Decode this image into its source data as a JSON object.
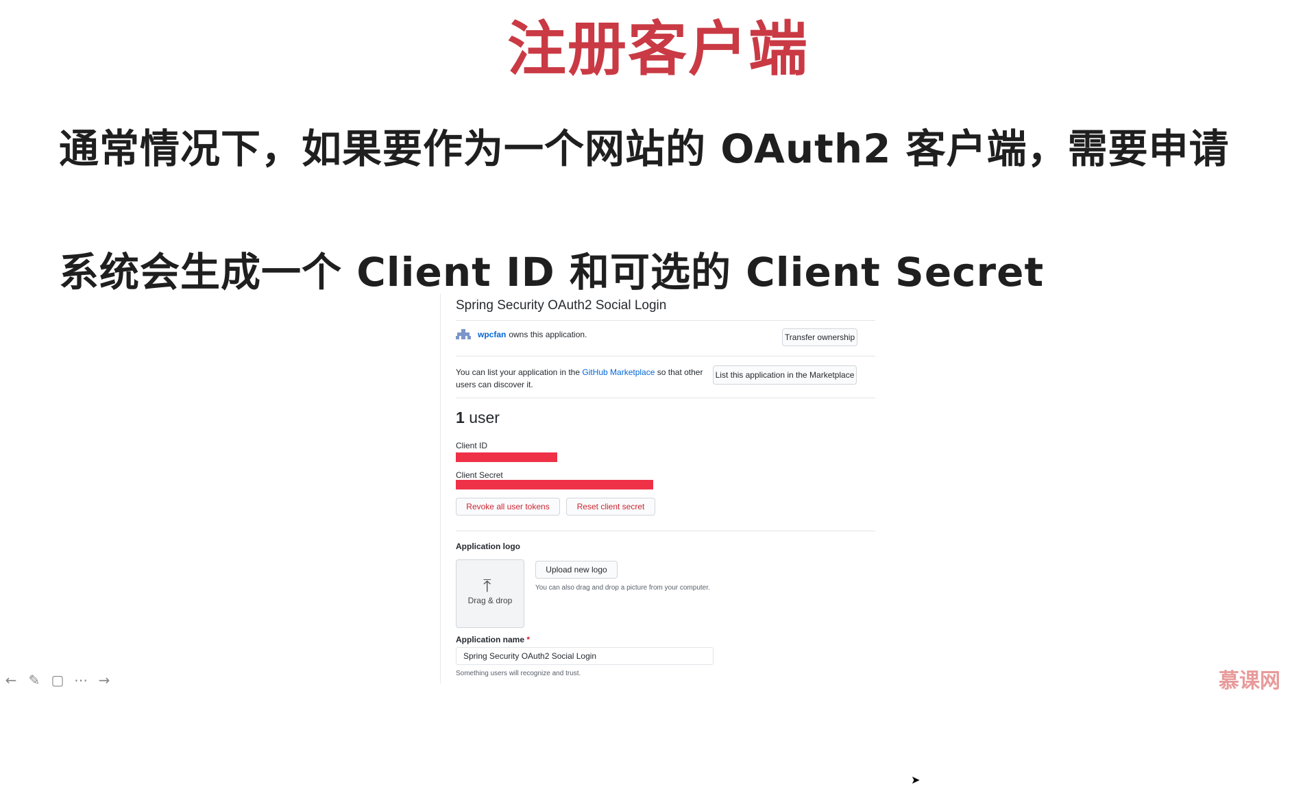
{
  "slide": {
    "title": "注册客户端",
    "line1": "通常情况下，如果要作为一个网站的 OAuth2 客户端，需要申请",
    "line2": "系统会生成一个 Client ID 和可选的 Client Secret"
  },
  "github_app": {
    "app_title": "Spring Security OAuth2 Social Login",
    "owner_name": "wpcfan",
    "owner_suffix": "owns this application.",
    "transfer_button": "Transfer ownership",
    "market_text_before": "You can list your application in the",
    "market_link": "GitHub Marketplace",
    "market_text_after": "so that other users can discover it.",
    "market_button": "List this application in the Marketplace",
    "users_count": "1",
    "users_label": "user",
    "client_id_label": "Client ID",
    "client_secret_label": "Client Secret",
    "revoke_button": "Revoke all user tokens",
    "reset_button": "Reset client secret",
    "logo_section_label": "Application logo",
    "drag_drop_text": "Drag & drop",
    "upload_button": "Upload new logo",
    "upload_hint": "You can also drag and drop a picture from your computer.",
    "app_name_label": "Application name",
    "required_mark": "*",
    "app_name_value": "Spring Security OAuth2 Social Login",
    "app_name_hint": "Something users will recognize and trust."
  },
  "watermark": "慕课网",
  "toolbar_icons": [
    "arrow-left-icon",
    "pen-icon",
    "screen-icon",
    "more-icon",
    "arrow-right-icon"
  ],
  "colors": {
    "title_red": "#c93a44",
    "redaction_red": "#ef3147",
    "link_blue": "#0366d6",
    "danger_red": "#cb2431"
  }
}
